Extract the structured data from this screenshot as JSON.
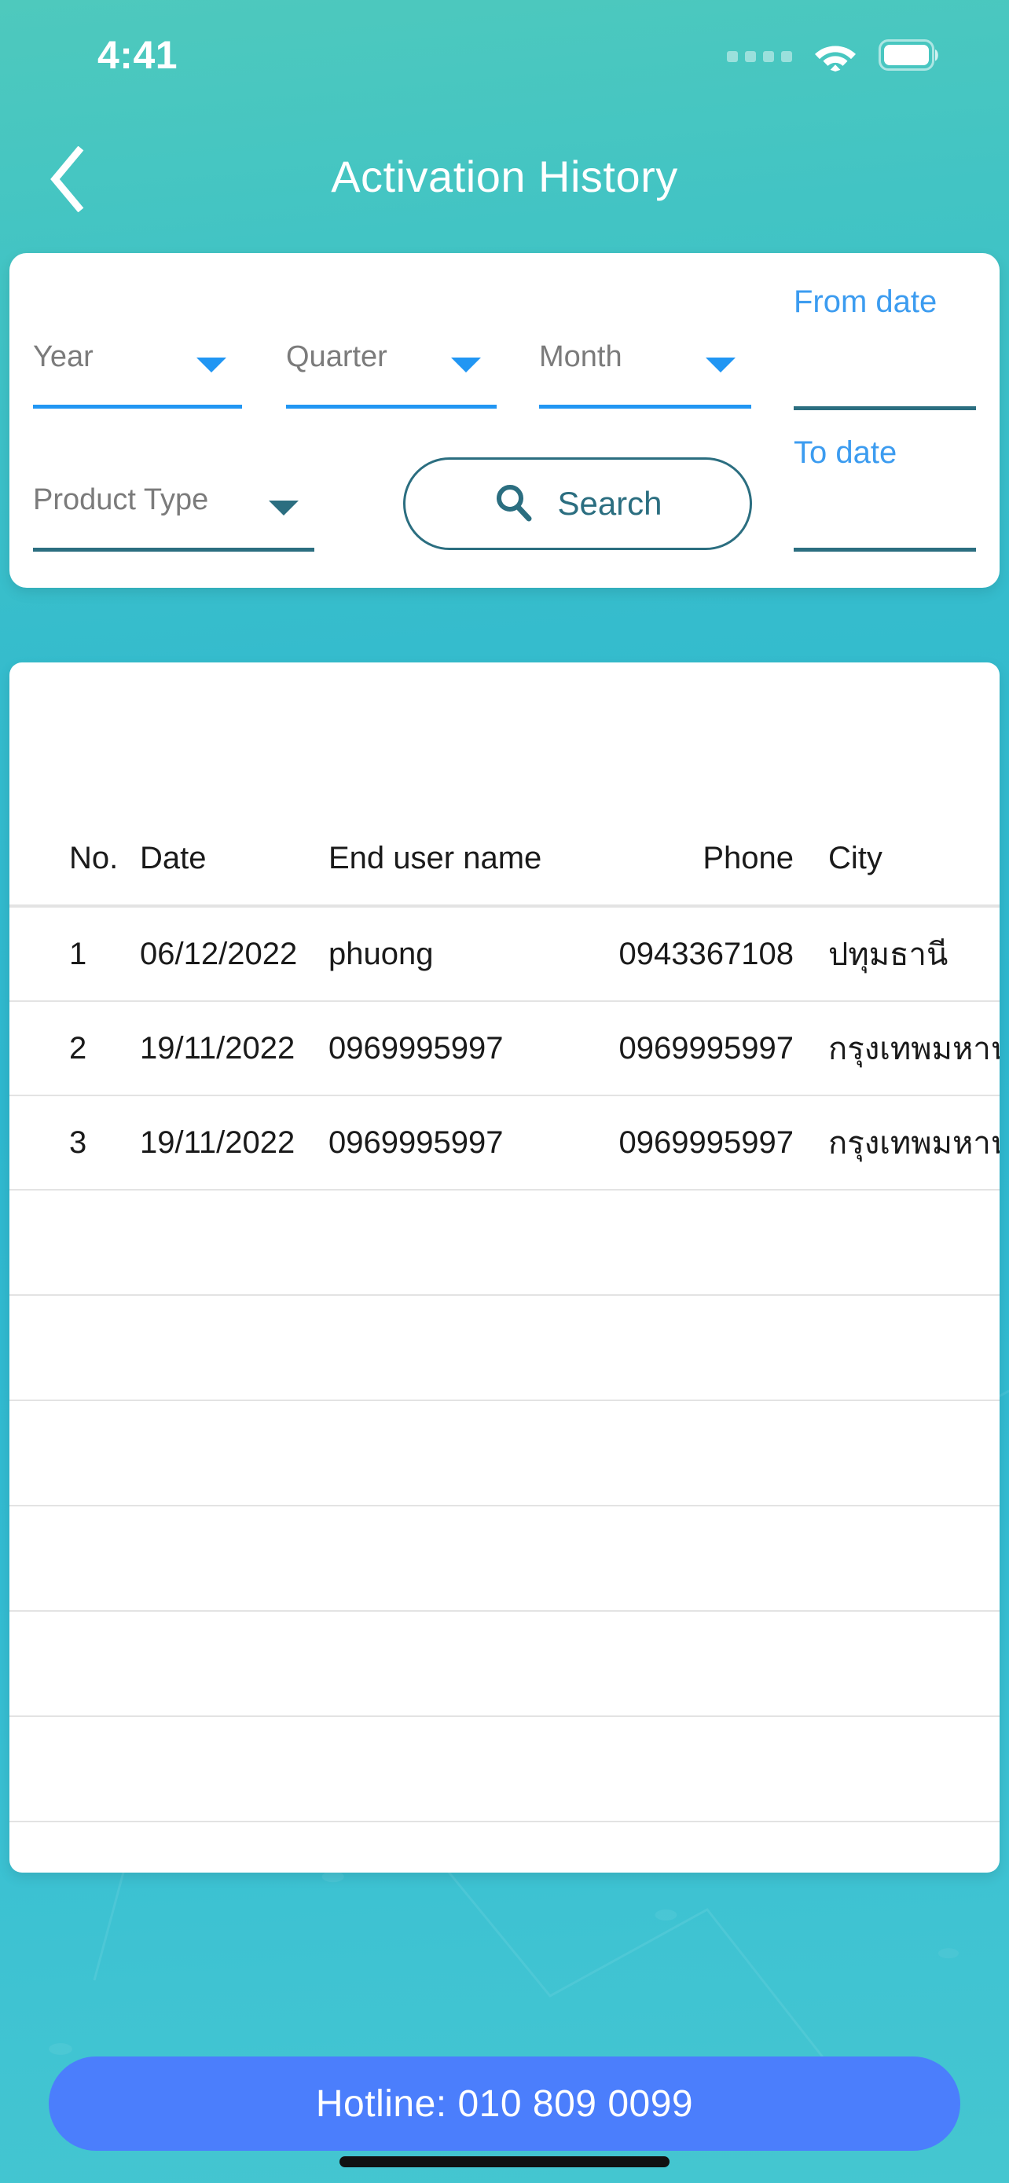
{
  "status_bar": {
    "time": "4:41",
    "signal_icon": "signal-dots-icon",
    "wifi_icon": "wifi-icon",
    "battery_icon": "battery-full-icon"
  },
  "header": {
    "back_icon": "chevron-left-icon",
    "title": "Activation History"
  },
  "filters": {
    "year": {
      "label": "Year",
      "arrow_icon": "chevron-down-icon"
    },
    "quarter": {
      "label": "Quarter",
      "arrow_icon": "chevron-down-icon"
    },
    "month": {
      "label": "Month",
      "arrow_icon": "chevron-down-icon"
    },
    "product_type": {
      "label": "Product Type",
      "arrow_icon": "chevron-down-icon"
    },
    "from_date": {
      "label": "From date",
      "value": ""
    },
    "to_date": {
      "label": "To date",
      "value": ""
    },
    "search": {
      "label": "Search",
      "icon": "search-icon"
    }
  },
  "table": {
    "columns": [
      "No.",
      "Date",
      "End user name",
      "Phone",
      "City"
    ],
    "rows": [
      {
        "no": "1",
        "date": "06/12/2022",
        "user": "phuong",
        "phone": "0943367108",
        "city": "ปทุมธานี"
      },
      {
        "no": "2",
        "date": "19/11/2022",
        "user": "0969995997",
        "phone": "0969995997",
        "city": "กรุงเทพมหานคร"
      },
      {
        "no": "3",
        "date": "19/11/2022",
        "user": "0969995997",
        "phone": "0969995997",
        "city": "กรุงเทพมหานคร"
      }
    ],
    "empty_row_count": 8
  },
  "footer": {
    "hotline_label": "Hotline: 010 809 0099"
  },
  "colors": {
    "bg_top": "#4ec9bd",
    "bg_bottom": "#45c6d0",
    "accent_blue": "#2196f3",
    "accent_teal": "#2b6e80",
    "hotline_blue": "#4b7efc",
    "card_white": "#ffffff"
  }
}
